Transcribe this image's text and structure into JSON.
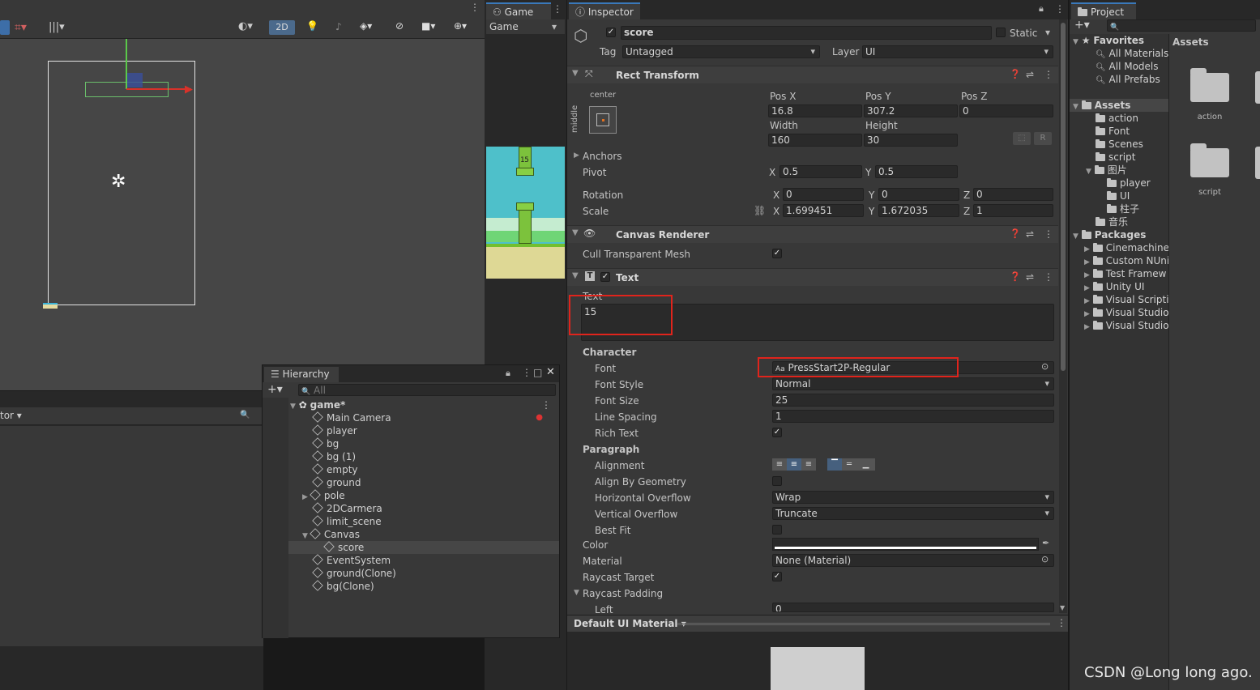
{
  "scene": {
    "toolbar": {
      "mode_2d": "2D"
    },
    "lower_left": {
      "dropdown_label": "tor"
    }
  },
  "game": {
    "tab_label": "Game",
    "display_label": "Game",
    "pipe_score": "15"
  },
  "inspector": {
    "tab_label": "Inspector",
    "object_name": "score",
    "static_label": "Static",
    "tag_label": "Tag",
    "tag_value": "Untagged",
    "layer_label": "Layer",
    "layer_value": "UI",
    "rect_transform": {
      "title": "Rect Transform",
      "anchor_h": "center",
      "anchor_v": "middle",
      "pos_x_label": "Pos X",
      "pos_x": "16.8",
      "pos_y_label": "Pos Y",
      "pos_y": "307.2",
      "pos_z_label": "Pos Z",
      "pos_z": "0",
      "width_label": "Width",
      "width": "160",
      "height_label": "Height",
      "height": "30",
      "r_button": "R",
      "anchors_label": "Anchors",
      "pivot_label": "Pivot",
      "pivot_x": "0.5",
      "pivot_y": "0.5",
      "rotation_label": "Rotation",
      "rot_x": "0",
      "rot_y": "0",
      "rot_z": "0",
      "scale_label": "Scale",
      "scale_x": "1.699451",
      "scale_y": "1.672035",
      "scale_z": "1",
      "x": "X",
      "y": "Y",
      "z": "Z"
    },
    "canvas_renderer": {
      "title": "Canvas Renderer",
      "cull_label": "Cull Transparent Mesh"
    },
    "text": {
      "title": "Text",
      "text_label": "Text",
      "text_value": "15",
      "character_label": "Character",
      "font_label": "Font",
      "font_value": "PressStart2P-Regular",
      "font_prefix": "Aa",
      "font_style_label": "Font Style",
      "font_style_value": "Normal",
      "font_size_label": "Font Size",
      "font_size_value": "25",
      "line_spacing_label": "Line Spacing",
      "line_spacing_value": "1",
      "rich_text_label": "Rich Text",
      "paragraph_label": "Paragraph",
      "alignment_label": "Alignment",
      "align_geometry_label": "Align By Geometry",
      "h_overflow_label": "Horizontal Overflow",
      "h_overflow_value": "Wrap",
      "v_overflow_label": "Vertical Overflow",
      "v_overflow_value": "Truncate",
      "best_fit_label": "Best Fit",
      "color_label": "Color",
      "material_label": "Material",
      "material_value": "None (Material)",
      "raycast_target_label": "Raycast Target",
      "raycast_padding_label": "Raycast Padding",
      "left_label": "Left",
      "left_value": "0"
    },
    "footer_material": "Default UI Material"
  },
  "hierarchy": {
    "tab_label": "Hierarchy",
    "search_placeholder": "All",
    "scene_name": "game*",
    "items": [
      {
        "label": "Main Camera"
      },
      {
        "label": "player"
      },
      {
        "label": "bg"
      },
      {
        "label": "bg (1)"
      },
      {
        "label": "empty"
      },
      {
        "label": "ground"
      },
      {
        "label": "pole"
      },
      {
        "label": "2DCarmera"
      },
      {
        "label": "limit_scene"
      },
      {
        "label": "Canvas"
      },
      {
        "label": "score"
      },
      {
        "label": "EventSystem"
      },
      {
        "label": "ground(Clone)"
      },
      {
        "label": "bg(Clone)"
      }
    ]
  },
  "project": {
    "tab_label": "Project",
    "favorites_label": "Favorites",
    "favorites": [
      {
        "label": "All Materials"
      },
      {
        "label": "All Models"
      },
      {
        "label": "All Prefabs"
      }
    ],
    "assets_label": "Assets",
    "assets": [
      {
        "label": "action"
      },
      {
        "label": "Font"
      },
      {
        "label": "Scenes"
      },
      {
        "label": "script"
      },
      {
        "label": "图片"
      },
      {
        "label": "player"
      },
      {
        "label": "UI"
      },
      {
        "label": "柱子"
      },
      {
        "label": "音乐"
      }
    ],
    "packages_label": "Packages",
    "packages": [
      {
        "label": "Cinemachine"
      },
      {
        "label": "Custom NUni"
      },
      {
        "label": "Test Framew"
      },
      {
        "label": "Unity UI"
      },
      {
        "label": "Visual Scripti"
      },
      {
        "label": "Visual Studio"
      },
      {
        "label": "Visual Studio"
      }
    ],
    "grid_header": "Assets",
    "grid_items": [
      {
        "label": "action"
      },
      {
        "label": "script"
      }
    ]
  },
  "watermark": "CSDN @Long long ago.",
  "colors": {
    "highlight_red": "#e0241c",
    "accent_blue": "#3a79bb",
    "selection": "#2c5d87"
  }
}
